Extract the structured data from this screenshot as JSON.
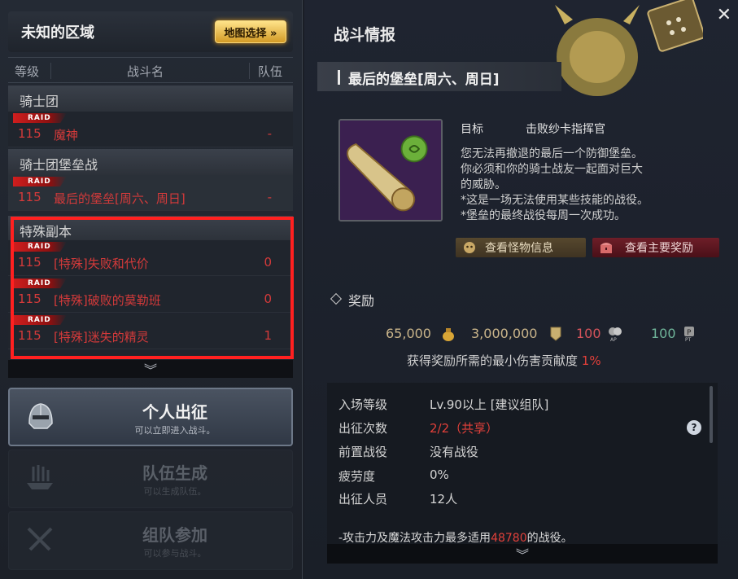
{
  "left": {
    "area_title": "未知的区域",
    "map_button": "地图选择 »",
    "columns": {
      "level": "等级",
      "battle_name": "战斗名",
      "party": "队伍"
    },
    "groups": [
      {
        "label": "骑士团",
        "entries": [
          {
            "badge": "RAID",
            "level": "115",
            "name": "魔神",
            "party": "-"
          }
        ]
      },
      {
        "label": "骑士团堡垒战",
        "entries": [
          {
            "badge": "RAID",
            "level": "115",
            "name": "最后的堡垒[周六、周日]",
            "party": "-"
          }
        ]
      },
      {
        "label": "特殊副本",
        "entries": [
          {
            "badge": "RAID",
            "level": "115",
            "name": "[特殊]失败和代价",
            "party": "0"
          },
          {
            "badge": "RAID",
            "level": "115",
            "name": "[特殊]破败的莫勒班",
            "party": "0"
          },
          {
            "badge": "RAID",
            "level": "115",
            "name": "[特殊]迷失的精灵",
            "party": "1"
          }
        ]
      }
    ],
    "modes": {
      "solo": {
        "title": "个人出征",
        "sub": "可以立即进入战斗。",
        "icon": "helmet-icon"
      },
      "party": {
        "title": "队伍生成",
        "sub": "可以生成队伍。",
        "icon": "ship-icon"
      },
      "join": {
        "title": "组队参加",
        "sub": "可以参与战斗。",
        "icon": "crossed-swords-icon"
      }
    },
    "scroll_icon": "chevron-down-double-icon"
  },
  "right": {
    "title": "战斗情报",
    "close_icon": "close-icon",
    "battle_name": "最后的堡垒[周六、周日]",
    "objective_label": "目标",
    "objective_value": "击败纱卡指挥官",
    "description": [
      "您无法再撤退的最后一个防御堡垒。",
      "你必须和你的骑士战友一起面对巨大",
      "的威胁。",
      "*这是一场无法使用某些技能的战役。",
      "*堡垒的最终战役每周一次成功。"
    ],
    "monster_button": "查看怪物信息",
    "reward_button": "查看主要奖励",
    "reward_title": "奖励",
    "rewards": {
      "gold": "65,000",
      "fame": "3,000,000",
      "ap": "100",
      "pt": "100"
    },
    "reward_icon_labels": {
      "ap": "AP",
      "pt": "PT",
      "pt_badge": "P"
    },
    "min_rate_text": "获得奖励所需的最小伤害贡献度",
    "min_rate_value": "1%",
    "info": [
      {
        "label": "入场等级",
        "value": "Lv.90以上 [建议组队]"
      },
      {
        "label": "出征次数",
        "value": "2/2（共享）"
      },
      {
        "label": "前置战役",
        "value": "没有战役"
      },
      {
        "label": "疲劳度",
        "value": "0%"
      },
      {
        "label": "出征人员",
        "value": "12人"
      }
    ],
    "help_icon": "?",
    "note_prefix": "-攻击力及魔法攻击力最多适用",
    "note_value": "48780",
    "note_suffix": "的战役。"
  },
  "colors": {
    "raid_red": "#d01e1e",
    "accent_gold": "#e6b94a",
    "highlight_red": "#ff2020"
  }
}
